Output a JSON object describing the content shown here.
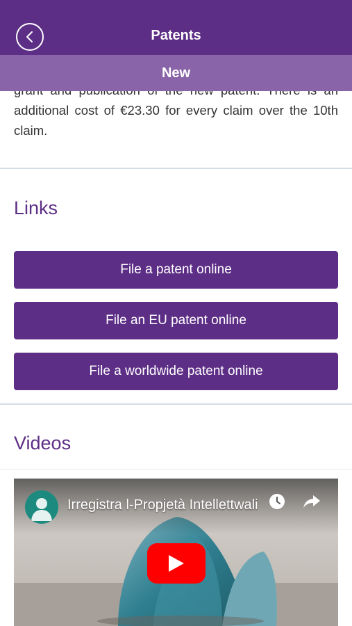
{
  "header": {
    "title": "Patents",
    "back_icon": "chevron-left-icon"
  },
  "subheader": {
    "label": "New"
  },
  "body_text": "grant and publication of the new patent. There is an additional cost of €23.30 for every claim over the 10th claim.",
  "links": {
    "title": "Links",
    "buttons": [
      {
        "label": "File a patent online"
      },
      {
        "label": "File an EU patent online"
      },
      {
        "label": "File a worldwide patent online"
      }
    ]
  },
  "videos": {
    "title": "Videos",
    "items": [
      {
        "title": "Irregistra l-Propjetà Intellettwali",
        "play_icon": "play-icon",
        "clock_icon": "clock-icon",
        "share_icon": "share-icon"
      }
    ]
  },
  "colors": {
    "primary": "#5d2e86",
    "subheader": "#8a64a8",
    "play_button": "#ff0000"
  }
}
